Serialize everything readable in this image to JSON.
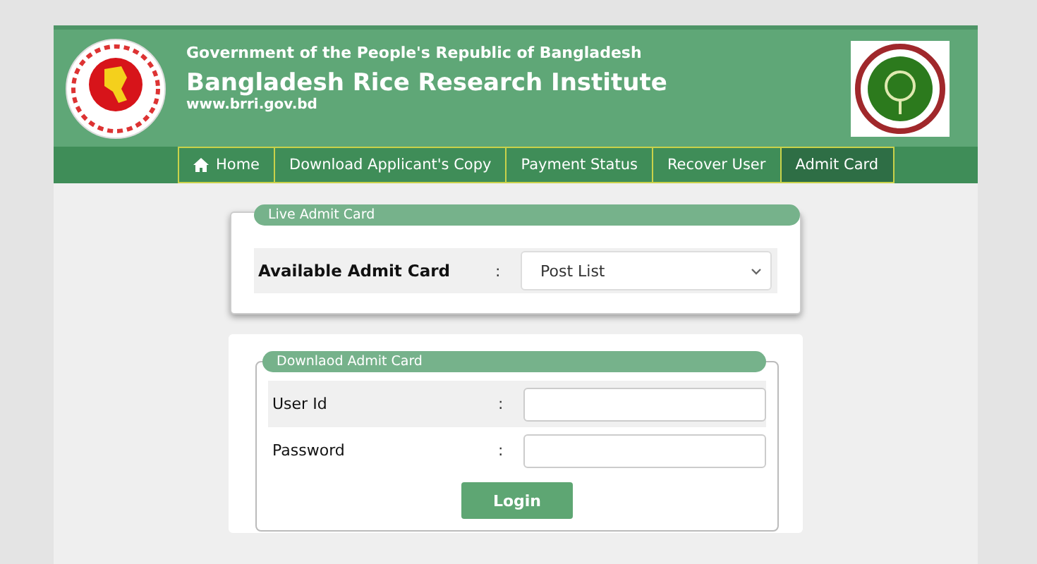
{
  "header": {
    "government": "Government of the People's Republic of Bangladesh",
    "title": "Bangladesh Rice Research Institute",
    "website": "www.brri.gov.bd"
  },
  "nav": [
    {
      "label": "Home",
      "kind": "home",
      "selected": false
    },
    {
      "label": "Download Applicant's Copy",
      "kind": "link",
      "selected": false
    },
    {
      "label": "Payment Status",
      "kind": "link",
      "selected": false
    },
    {
      "label": "Recover User",
      "kind": "link",
      "selected": false
    },
    {
      "label": "Admit Card",
      "kind": "link",
      "selected": true
    }
  ],
  "live_admit_card": {
    "legend": "Live Admit Card",
    "label": "Available Admit Card",
    "separator": ":",
    "select_value": "Post List"
  },
  "download_admit_card": {
    "legend": "Downlaod Admit Card",
    "fields": [
      {
        "label": "User Id",
        "separator": ":"
      },
      {
        "label": "Password",
        "separator": ":"
      }
    ],
    "button": "Login"
  }
}
